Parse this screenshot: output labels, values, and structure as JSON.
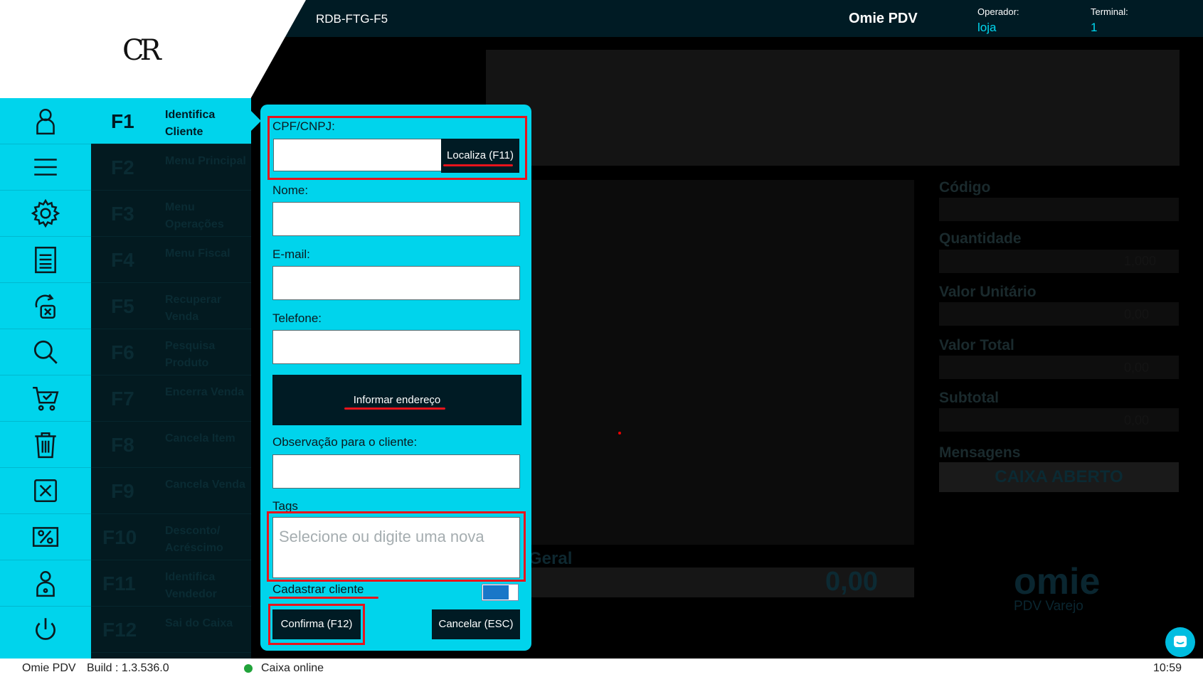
{
  "header": {
    "terminal_id": "RDB-FTG-F5",
    "app_name": "Omie PDV",
    "operator_label": "Operador:",
    "operator_value": "loja",
    "terminal_label": "Terminal:",
    "terminal_value": "1",
    "logo_text": "CR"
  },
  "sidebar_icons": [
    "user-icon",
    "menu-icon",
    "gear-icon",
    "receipt-icon",
    "recover-sale-icon",
    "search-icon",
    "cart-check-icon",
    "trash-icon",
    "close-box-icon",
    "percent-icon",
    "user-badge-icon",
    "power-icon"
  ],
  "fkeys": [
    {
      "key": "F1",
      "label": "Identifica Cliente"
    },
    {
      "key": "F2",
      "label": "Menu Principal"
    },
    {
      "key": "F3",
      "label": "Menu Operações"
    },
    {
      "key": "F4",
      "label": "Menu Fiscal"
    },
    {
      "key": "F5",
      "label": "Recuperar Venda"
    },
    {
      "key": "F6",
      "label": "Pesquisa Produto"
    },
    {
      "key": "F7",
      "label": "Encerra Venda"
    },
    {
      "key": "F8",
      "label": "Cancela Item"
    },
    {
      "key": "F9",
      "label": "Cancela Venda"
    },
    {
      "key": "F10",
      "label": "Desconto/ Acréscimo"
    },
    {
      "key": "F11",
      "label": "Identifica Vendedor"
    },
    {
      "key": "F12",
      "label": "Sai do Caixa"
    }
  ],
  "modal": {
    "cpf_label": "CPF/CNPJ:",
    "cpf_value": "",
    "localiza_button": "Localiza (F11)",
    "nome_label": "Nome:",
    "nome_value": "",
    "email_label": "E-mail:",
    "email_value": "",
    "telefone_label": "Telefone:",
    "telefone_value": "",
    "endereco_button": "Informar endereço",
    "observacao_label": "Observação para o cliente:",
    "observacao_value": "",
    "tags_label": "Tags",
    "tags_placeholder": "Selecione ou digite uma nova",
    "cadastrar_label": "Cadastrar cliente",
    "cadastrar_toggle_on": true,
    "confirma_button": "Confirma (F12)",
    "cancelar_button": "Cancelar (ESC)"
  },
  "background": {
    "fields": [
      {
        "label": "Código",
        "value": ""
      },
      {
        "label": "Quantidade",
        "value": "1,000"
      },
      {
        "label": "Valor Unitário",
        "value": "0,00"
      },
      {
        "label": "Valor Total",
        "value": "0,00"
      },
      {
        "label": "Subtotal",
        "value": "0,00"
      }
    ],
    "mensagens_label": "Mensagens",
    "caixa_status": "CAIXA ABERTO",
    "total_geral_label": "Geral",
    "total_geral_value": "0,00",
    "brand": "omie",
    "brand_sub": "PDV Varejo"
  },
  "footer": {
    "app": "Omie PDV",
    "build": "Build : 1.3.536.0",
    "status": "Caixa online",
    "status_color": "#21a33a",
    "time": "10:59"
  },
  "colors": {
    "accent": "#00d4ec",
    "dark": "#001b24",
    "highlight": "#e8141c"
  }
}
